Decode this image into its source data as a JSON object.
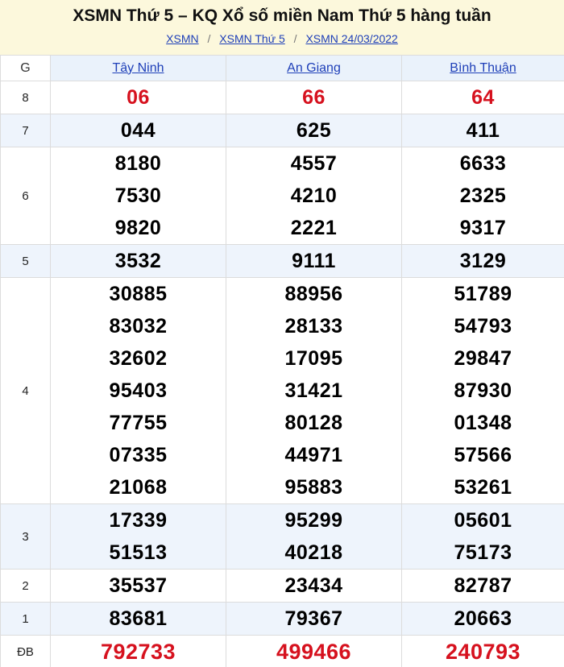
{
  "header": {
    "title": "XSMN Thứ 5 – KQ Xổ số miền Nam Thứ 5 hàng tuần",
    "breadcrumb": [
      "XSMN",
      "XSMN Thứ 5",
      "XSMN 24/03/2022"
    ],
    "separator": "/"
  },
  "colors": {
    "header_bg": "#fcf8dc",
    "link": "#1e3fb8",
    "highlight_number": "#d6111e",
    "alt_row_bg": "#eef4fc"
  },
  "table": {
    "prize_column_header": "G",
    "provinces": [
      "Tây Ninh",
      "An Giang",
      "Bình Thuận"
    ],
    "rows": [
      {
        "label": "8",
        "values": [
          [
            "06"
          ],
          [
            "66"
          ],
          [
            "64"
          ]
        ]
      },
      {
        "label": "7",
        "values": [
          [
            "044"
          ],
          [
            "625"
          ],
          [
            "411"
          ]
        ]
      },
      {
        "label": "6",
        "values": [
          [
            "8180",
            "7530",
            "9820"
          ],
          [
            "4557",
            "4210",
            "2221"
          ],
          [
            "6633",
            "2325",
            "9317"
          ]
        ]
      },
      {
        "label": "5",
        "values": [
          [
            "3532"
          ],
          [
            "9111"
          ],
          [
            "3129"
          ]
        ]
      },
      {
        "label": "4",
        "values": [
          [
            "30885",
            "83032",
            "32602",
            "95403",
            "77755",
            "07335",
            "21068"
          ],
          [
            "88956",
            "28133",
            "17095",
            "31421",
            "80128",
            "44971",
            "95883"
          ],
          [
            "51789",
            "54793",
            "29847",
            "87930",
            "01348",
            "57566",
            "53261"
          ]
        ]
      },
      {
        "label": "3",
        "values": [
          [
            "17339",
            "51513"
          ],
          [
            "95299",
            "40218"
          ],
          [
            "05601",
            "75173"
          ]
        ]
      },
      {
        "label": "2",
        "values": [
          [
            "35537"
          ],
          [
            "23434"
          ],
          [
            "82787"
          ]
        ]
      },
      {
        "label": "1",
        "values": [
          [
            "83681"
          ],
          [
            "79367"
          ],
          [
            "20663"
          ]
        ]
      },
      {
        "label": "ĐB",
        "values": [
          [
            "792733"
          ],
          [
            "499466"
          ],
          [
            "240793"
          ]
        ]
      }
    ]
  }
}
